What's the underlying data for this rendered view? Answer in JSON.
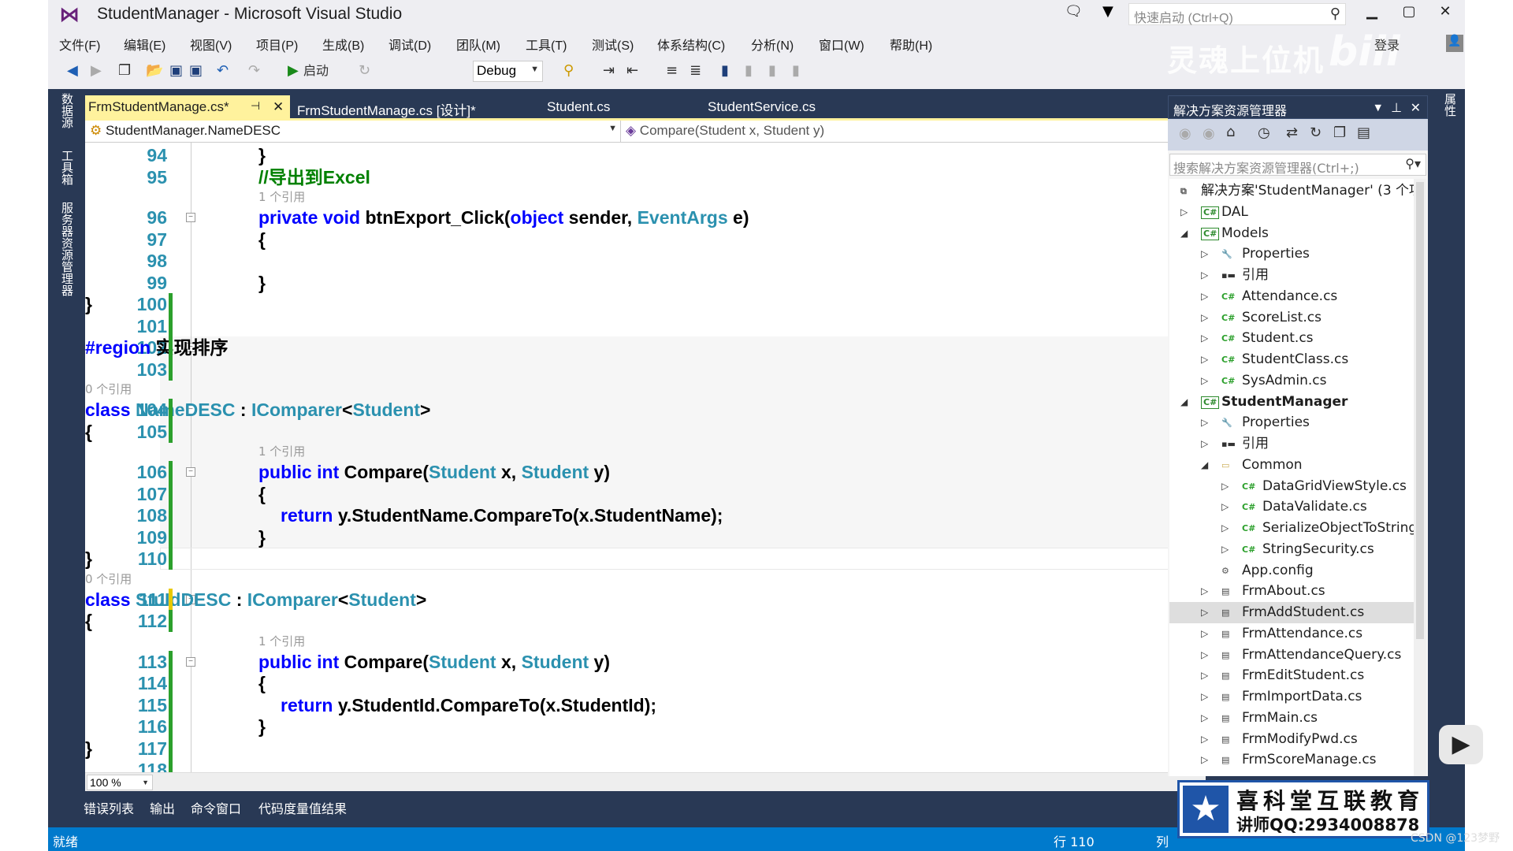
{
  "window": {
    "title": "StudentManager - Microsoft Visual Studio",
    "quick_launch": "快速启动 (Ctrl+Q)",
    "login": "登录"
  },
  "menu": [
    "文件(F)",
    "编辑(E)",
    "视图(V)",
    "项目(P)",
    "生成(B)",
    "调试(D)",
    "团队(M)",
    "工具(T)",
    "测试(S)",
    "体系结构(C)",
    "分析(N)",
    "窗口(W)",
    "帮助(H)"
  ],
  "toolbar": {
    "start_label": "启动",
    "config": "Debug"
  },
  "watermark": {
    "channel": "灵魂上位机",
    "site": "bilibili",
    "csdn": "CSDN @123梦野",
    "logo_line1": "喜科堂互联教育",
    "logo_line2": "讲师QQ:2934008878"
  },
  "left_strip": [
    "数据源",
    "工具箱",
    "服务器资源管理器"
  ],
  "right_strip": [
    "属性"
  ],
  "tabs": [
    {
      "label": "FrmStudentManage.cs*",
      "active": true
    },
    {
      "label": "FrmStudentManage.cs [设计]*"
    },
    {
      "label": "Student.cs"
    },
    {
      "label": "StudentService.cs"
    }
  ],
  "nav": {
    "type": "StudentManager.NameDESC",
    "member": "Compare(Student x, Student y)"
  },
  "code": [
    {
      "n": "94",
      "i": 2,
      "t": [
        [
          "}",
          ""
        ]
      ]
    },
    {
      "n": "95",
      "i": 2,
      "t": [
        [
          "//导出到Excel",
          "cm"
        ]
      ]
    },
    {
      "lens": "1 个引用",
      "i": 2
    },
    {
      "n": "96",
      "i": 2,
      "f": 1,
      "t": [
        [
          "private",
          "kw"
        ],
        [
          " ",
          ""
        ],
        [
          "void",
          "kw"
        ],
        [
          " btnExport_Click(",
          ""
        ],
        [
          "object",
          "kw"
        ],
        [
          " sender, ",
          ""
        ],
        [
          "EventArgs",
          "ty"
        ],
        [
          " e)",
          ""
        ]
      ]
    },
    {
      "n": "97",
      "i": 2,
      "t": [
        [
          "{",
          ""
        ]
      ]
    },
    {
      "n": "98",
      "i": 2,
      "t": []
    },
    {
      "n": "99",
      "i": 2,
      "t": [
        [
          "}",
          ""
        ]
      ]
    },
    {
      "n": "100",
      "i": 1,
      "t": [
        [
          "}",
          ""
        ]
      ]
    },
    {
      "n": "101",
      "i": 1,
      "t": []
    },
    {
      "n": "102",
      "i": 1,
      "f": 1,
      "t": [
        [
          "#region",
          "kw"
        ],
        [
          " 实现排序",
          ""
        ]
      ]
    },
    {
      "n": "103",
      "i": 1,
      "t": []
    },
    {
      "lens": "0 个引用",
      "i": 1
    },
    {
      "n": "104",
      "i": 1,
      "f": 1,
      "t": [
        [
          "class",
          "kw"
        ],
        [
          " ",
          ""
        ],
        [
          "NameDESC",
          "ty"
        ],
        [
          " : ",
          ""
        ],
        [
          "IComparer",
          "ty"
        ],
        [
          "<",
          ""
        ],
        [
          "Student",
          "ty"
        ],
        [
          ">",
          ""
        ]
      ]
    },
    {
      "n": "105",
      "i": 1,
      "t": [
        [
          "{",
          ""
        ]
      ]
    },
    {
      "lens": "1 个引用",
      "i": 2
    },
    {
      "n": "106",
      "i": 2,
      "f": 1,
      "t": [
        [
          "public",
          "kw"
        ],
        [
          " ",
          ""
        ],
        [
          "int",
          "kw"
        ],
        [
          " Compare(",
          ""
        ],
        [
          "Student",
          "ty"
        ],
        [
          " x, ",
          ""
        ],
        [
          "Student",
          "ty"
        ],
        [
          " y)",
          ""
        ]
      ]
    },
    {
      "n": "107",
      "i": 2,
      "t": [
        [
          "{",
          ""
        ]
      ]
    },
    {
      "n": "108",
      "i": 3,
      "t": [
        [
          "return",
          "kw"
        ],
        [
          " y.StudentName.CompareTo(x.StudentName);",
          ""
        ]
      ]
    },
    {
      "n": "109",
      "i": 2,
      "t": [
        [
          "}",
          ""
        ]
      ]
    },
    {
      "n": "110",
      "i": 1,
      "t": [
        [
          "}",
          ""
        ]
      ],
      "current": true
    },
    {
      "lens": "0 个引用",
      "i": 1
    },
    {
      "n": "111",
      "i": 1,
      "f": 1,
      "t": [
        [
          "class",
          "kw"
        ],
        [
          " ",
          ""
        ],
        [
          "StuIdDESC",
          "ty"
        ],
        [
          " : ",
          ""
        ],
        [
          "IComparer",
          "ty"
        ],
        [
          "<",
          ""
        ],
        [
          "Student",
          "ty"
        ],
        [
          ">",
          ""
        ]
      ]
    },
    {
      "n": "112",
      "i": 1,
      "t": [
        [
          "{",
          ""
        ]
      ]
    },
    {
      "lens": "1 个引用",
      "i": 2
    },
    {
      "n": "113",
      "i": 2,
      "f": 1,
      "t": [
        [
          "public",
          "kw"
        ],
        [
          " ",
          ""
        ],
        [
          "int",
          "kw"
        ],
        [
          " Compare(",
          ""
        ],
        [
          "Student",
          "ty"
        ],
        [
          " x, ",
          ""
        ],
        [
          "Student",
          "ty"
        ],
        [
          " y)",
          ""
        ]
      ]
    },
    {
      "n": "114",
      "i": 2,
      "t": [
        [
          "{",
          ""
        ]
      ]
    },
    {
      "n": "115",
      "i": 3,
      "t": [
        [
          "return",
          "kw"
        ],
        [
          " y.StudentId.CompareTo(x.StudentId);",
          ""
        ]
      ]
    },
    {
      "n": "116",
      "i": 2,
      "t": [
        [
          "}",
          ""
        ]
      ]
    },
    {
      "n": "117",
      "i": 1,
      "t": [
        [
          "}",
          ""
        ]
      ]
    },
    {
      "n": "118",
      "i": 1,
      "t": []
    }
  ],
  "zoom_level": "100 %",
  "bottom_tabs": [
    "错误列表",
    "输出",
    "命令窗口",
    "代码度量值结果"
  ],
  "solution_explorer": {
    "title": "解决方案资源管理器",
    "search_placeholder": "搜索解决方案资源管理器(Ctrl+;)",
    "tree": [
      {
        "label": "解决方案'StudentManager' (3 个项",
        "lvl": 0,
        "icon": "solution",
        "exp": "none"
      },
      {
        "label": "DAL",
        "lvl": 0,
        "icon": "csproj",
        "exp": "collapsed"
      },
      {
        "label": "Models",
        "lvl": 0,
        "icon": "csproj",
        "exp": "expanded"
      },
      {
        "label": "Properties",
        "lvl": 1,
        "icon": "wrench",
        "exp": "collapsed"
      },
      {
        "label": "引用",
        "lvl": 1,
        "icon": "references",
        "exp": "collapsed"
      },
      {
        "label": "Attendance.cs",
        "lvl": 1,
        "icon": "cs",
        "exp": "collapsed"
      },
      {
        "label": "ScoreList.cs",
        "lvl": 1,
        "icon": "cs",
        "exp": "collapsed"
      },
      {
        "label": "Student.cs",
        "lvl": 1,
        "icon": "cs",
        "exp": "collapsed"
      },
      {
        "label": "StudentClass.cs",
        "lvl": 1,
        "icon": "cs",
        "exp": "collapsed"
      },
      {
        "label": "SysAdmin.cs",
        "lvl": 1,
        "icon": "cs",
        "exp": "collapsed"
      },
      {
        "label": "StudentManager",
        "lvl": 0,
        "icon": "csproj",
        "exp": "expanded",
        "bold": true
      },
      {
        "label": "Properties",
        "lvl": 1,
        "icon": "wrench",
        "exp": "collapsed"
      },
      {
        "label": "引用",
        "lvl": 1,
        "icon": "references",
        "exp": "collapsed"
      },
      {
        "label": "Common",
        "lvl": 1,
        "icon": "folder",
        "exp": "expanded"
      },
      {
        "label": "DataGridViewStyle.cs",
        "lvl": 2,
        "icon": "cs",
        "exp": "collapsed"
      },
      {
        "label": "DataValidate.cs",
        "lvl": 2,
        "icon": "cs",
        "exp": "collapsed"
      },
      {
        "label": "SerializeObjectToString",
        "lvl": 2,
        "icon": "cs",
        "exp": "collapsed"
      },
      {
        "label": "StringSecurity.cs",
        "lvl": 2,
        "icon": "cs",
        "exp": "collapsed"
      },
      {
        "label": "App.config",
        "lvl": 1,
        "icon": "config",
        "exp": "none"
      },
      {
        "label": "FrmAbout.cs",
        "lvl": 1,
        "icon": "form",
        "exp": "collapsed"
      },
      {
        "label": "FrmAddStudent.cs",
        "lvl": 1,
        "icon": "form",
        "exp": "collapsed",
        "selected": true
      },
      {
        "label": "FrmAttendance.cs",
        "lvl": 1,
        "icon": "form",
        "exp": "collapsed"
      },
      {
        "label": "FrmAttendanceQuery.cs",
        "lvl": 1,
        "icon": "form",
        "exp": "collapsed"
      },
      {
        "label": "FrmEditStudent.cs",
        "lvl": 1,
        "icon": "form",
        "exp": "collapsed"
      },
      {
        "label": "FrmImportData.cs",
        "lvl": 1,
        "icon": "form",
        "exp": "collapsed"
      },
      {
        "label": "FrmMain.cs",
        "lvl": 1,
        "icon": "form",
        "exp": "collapsed"
      },
      {
        "label": "FrmModifyPwd.cs",
        "lvl": 1,
        "icon": "form",
        "exp": "collapsed"
      },
      {
        "label": "FrmScoreManage.cs",
        "lvl": 1,
        "icon": "form",
        "exp": "collapsed"
      }
    ]
  },
  "status": {
    "ready": "就绪",
    "line": "行 110",
    "col": "列"
  },
  "colors": {
    "accent": "#007acc",
    "keyword": "#0000ff",
    "type": "#2b91af",
    "comment": "#008000",
    "active_tab": "#fff29d",
    "frame": "#293955"
  }
}
